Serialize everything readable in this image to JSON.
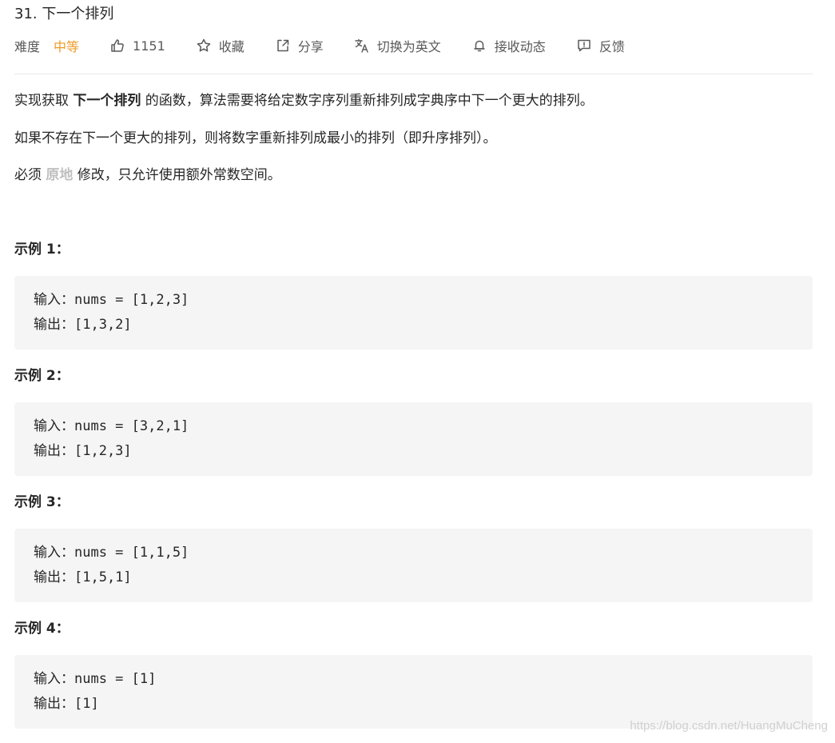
{
  "problem": {
    "title": "31. 下一个排列"
  },
  "meta": {
    "difficulty_label": "难度",
    "difficulty_value": "中等",
    "difficulty_color": "#ef9a28",
    "likes": "1151",
    "favorite_label": "收藏",
    "share_label": "分享",
    "translate_label": "切换为英文",
    "subscribe_label": "接收动态",
    "feedback_label": "反馈"
  },
  "description": {
    "line1_prefix": "实现获取 ",
    "line1_bold": "下一个排列",
    "line1_suffix": " 的函数，算法需要将给定数字序列重新排列成字典序中下一个更大的排列。",
    "line2": "如果不存在下一个更大的排列，则将数字重新排列成最小的排列（即升序排列）。",
    "line3_prefix": "必须 ",
    "line3_bold": "原地",
    "line3_suffix": " 修改，只允许使用额外常数空间。"
  },
  "examples": [
    {
      "title": "示例 1：",
      "input": "输入：nums = [1,2,3]",
      "output": "输出：[1,3,2]"
    },
    {
      "title": "示例 2：",
      "input": "输入：nums = [3,2,1]",
      "output": "输出：[1,2,3]"
    },
    {
      "title": "示例 3：",
      "input": "输入：nums = [1,1,5]",
      "output": "输出：[1,5,1]"
    },
    {
      "title": "示例 4：",
      "input": "输入：nums = [1]",
      "output": "输出：[1]"
    }
  ],
  "watermark": "https://blog.csdn.net/HuangMuCheng",
  "icons": {
    "like": "thumbs-up-icon",
    "favorite": "star-icon",
    "share": "share-icon",
    "translate": "translate-icon",
    "subscribe": "bell-icon",
    "feedback": "feedback-icon"
  }
}
